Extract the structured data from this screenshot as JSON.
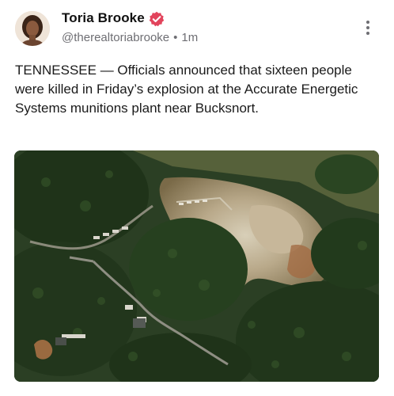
{
  "post": {
    "author": {
      "display_name": "Toria Brooke",
      "handle": "@therealtoriabrooke",
      "verified": true,
      "avatar_icon": "profile-photo"
    },
    "meta": {
      "separator": "•",
      "time": "1m"
    },
    "text": "TENNESSEE — Officials announced that sixteen people were killed in Friday’s explosion at the Accurate Energetic Systems munitions plant near Bucksnort.",
    "menu_icon": "more-vertical-icon",
    "image": {
      "description_icon": "aerial-photo"
    }
  },
  "colors": {
    "badge": "#e2445c",
    "handle_text": "#6e6e73",
    "body_text": "#1a1a1a"
  }
}
